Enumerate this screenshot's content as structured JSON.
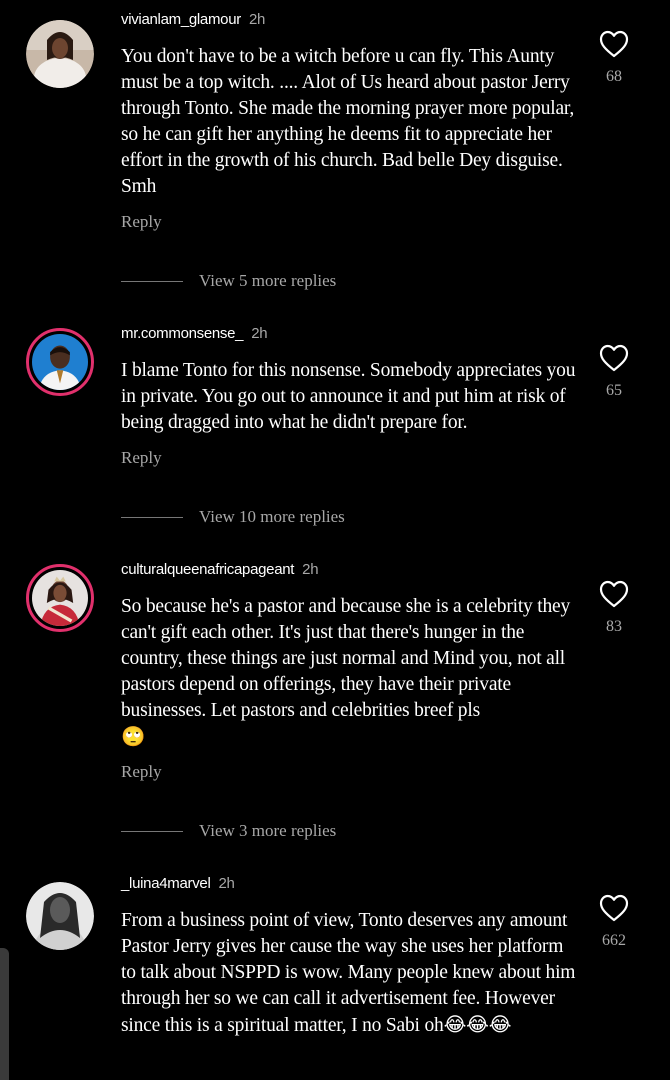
{
  "comments": [
    {
      "username": "vivianlam_glamour",
      "time": "2h",
      "text": "You don't have to be a witch before u can fly. This Aunty must be a top witch. .... Alot of Us heard about pastor Jerry through Tonto. She made the morning prayer more popular, so he can gift her anything he deems fit to appreciate her effort in the growth of his church. Bad belle Dey disguise. Smh",
      "reply_label": "Reply",
      "more_replies": "View 5 more replies",
      "likes": "68",
      "avatar": "avatar-woman-white-dress"
    },
    {
      "username": "mr.commonsense_",
      "time": "2h",
      "text": "I blame Tonto for this nonsense. Somebody appreciates you in private. You go out to announce it and put him at risk of being dragged into what he didn't prepare for.",
      "reply_label": "Reply",
      "more_replies": "View 10 more replies",
      "likes": "65",
      "avatar": "avatar-man-blue-background"
    },
    {
      "username": "culturalqueenafricapageant",
      "time": "2h",
      "text": "So because he's a pastor and because she is a celebrity they can't gift each other. It's just that there's hunger in the country, these things are just normal and Mind you, not all pastors depend on offerings, they have their private businesses. Let pastors and celebrities breef pls",
      "emoji": "🙄",
      "reply_label": "Reply",
      "more_replies": "View 3 more replies",
      "likes": "83",
      "avatar": "avatar-pageant-queen"
    },
    {
      "username": "_luina4marvel",
      "time": "2h",
      "text": "From a business point of view, Tonto deserves any amount Pastor Jerry gives her cause the way she uses her platform to talk about NSPPD is wow. Many people knew about him through her so we can call it advertisement fee. However since this is a spiritual matter, I no Sabi oh",
      "emoji": "😂😂😂",
      "likes": "662",
      "avatar": "avatar-woman-grayscale"
    }
  ],
  "icons": {
    "like": "heart-outline-icon"
  },
  "colors": {
    "background": "#000000",
    "text": "#ffffff",
    "secondary": "#a8a8a8",
    "story_ring": "#e1306c"
  }
}
